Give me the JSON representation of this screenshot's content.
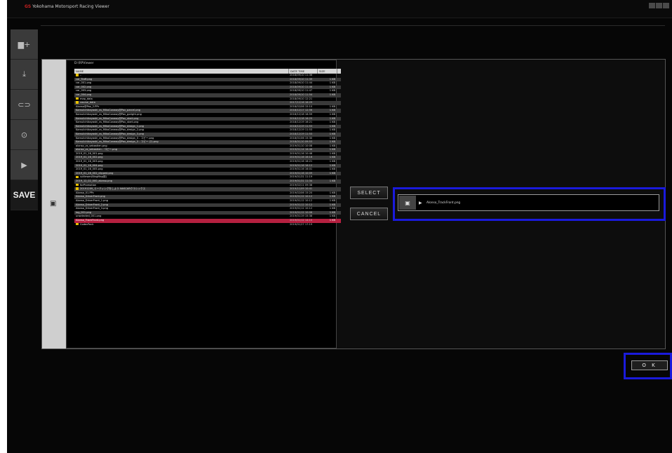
{
  "window": {
    "logo": "GS",
    "title": "Yokohama Motorsport Racing",
    "subtitle": "Viewer"
  },
  "sidebar": {
    "items": [
      {
        "name": "add-layer",
        "glyph": "▆+"
      },
      {
        "name": "import",
        "glyph": "⤓"
      },
      {
        "name": "vehicle",
        "glyph": "⊂⊃"
      },
      {
        "name": "gauge",
        "glyph": "⊙"
      },
      {
        "name": "play",
        "glyph": "▶"
      },
      {
        "name": "save",
        "label": "SAVE"
      }
    ]
  },
  "list": {
    "path": "D:\\RPViewer",
    "columns": [
      "NAME",
      "DATE TIME",
      "SIZE"
    ],
    "rows": [
      {
        "name": "..",
        "date": "2018/09/10 11:36",
        "size": "",
        "folder": true
      },
      {
        "name": "car_Traff.png",
        "date": "2018/09/10 11:39",
        "size": "1 KB"
      },
      {
        "name": "car_001.png",
        "date": "2018/09/10 11:44",
        "size": "1 KB"
      },
      {
        "name": "car_002.png",
        "date": "2018/09/10 11:46",
        "size": "1 KB"
      },
      {
        "name": "car_003.png",
        "date": "2018/09/10 11:47",
        "size": "1 KB"
      },
      {
        "name": "car_004.png",
        "date": "2018/09/10 11:54",
        "size": "1 KB"
      },
      {
        "name": "map_data",
        "date": "2018/09/10 12:21",
        "size": "",
        "folder": true
      },
      {
        "name": "course_data",
        "date": "2017/12/16 16:29",
        "size": "",
        "folder": true
      },
      {
        "name": "Alonso@Pax_2.PPc",
        "date": "2018/02/06 15:10",
        "size": "1 KB"
      },
      {
        "name": "Kamuiichikayashi_vs_MikoConway@Pax_parcel.png",
        "date": "2018/12/17 12:56",
        "size": "1 KB"
      },
      {
        "name": "Kamuiichikayashi_vs_MikoConway@Pax_goright.png",
        "date": "2018/12/18 16:59",
        "size": "1 KB"
      },
      {
        "name": "Kamuiichikayashi_vs_MikoConway@Pax_start.png",
        "date": "2018/12/18 16:25",
        "size": "1 KB"
      },
      {
        "name": "Kamuiichikayashi_vs_MikoConway@Pax_start.png",
        "date": "2018/12/19 16:21",
        "size": "1 KB"
      },
      {
        "name": "Kamuiichikayashi_vs_MikoConway@Pax_design_1.png",
        "date": "2018/12/19 11:53",
        "size": "1 KB"
      },
      {
        "name": "Kamuiichikayashi_vs_MikoConway@Pax_design_2.png",
        "date": "2018/12/19 11:53",
        "size": "1 KB"
      },
      {
        "name": "Kamuiichikayashi_vs_MikoConway@Pax_design_3.png",
        "date": "2018/12/19 11:53",
        "size": "1 KB"
      },
      {
        "name": "Kamuiichikayashi_vs_MikoConway@Pax_design_3 - コピー.png",
        "date": "2018/01/06 15:30",
        "size": "1 KB"
      },
      {
        "name": "Kamuiichikayashi_vs_MikoConway@Pax_design_3 - コピー (2).png",
        "date": "2018/01/10 09:53",
        "size": "1 KB"
      },
      {
        "name": "alonso_vs_sebastien.png",
        "date": "2019/01/10 10:08",
        "size": "1 KB"
      },
      {
        "name": "alonso_vs_sebastien - コピー.png",
        "date": "2019/01/14 16:46",
        "size": "1 KB"
      },
      {
        "name": "2019_01_16_001.png",
        "date": "2019/01/16 10:48",
        "size": "1 KB"
      },
      {
        "name": "2019_01_16_002.png",
        "date": "2019/01/16 16:16",
        "size": "1 KB"
      },
      {
        "name": "2019_01_16_003.png",
        "date": "2019/01/16 16:21",
        "size": "1 KB"
      },
      {
        "name": "2019_01_16_004.png",
        "date": "2019/01/16 16:12",
        "size": "1 KB"
      },
      {
        "name": "2019_01_16_005.png",
        "date": "2019/01/16 16:01",
        "size": "1 KB"
      },
      {
        "name": "2019_01_16_002_clipped.png",
        "date": "2019/01/16 10:09",
        "size": "1 KB"
      },
      {
        "name": "rpViewer(BingMap用)",
        "date": "2019/01/31 11:19",
        "size": "",
        "folder": true
      },
      {
        "name": "2019_12_02_000_alonso.png",
        "date": "2019/01/31 11:34",
        "size": "1 KB"
      },
      {
        "name": "forPromotion",
        "date": "2019/02/11 09:38",
        "size": "",
        "folder": true
      },
      {
        "name": "20191209_ミーティングをしよう NASCARクラシックス",
        "date": "2019/11/09 10:41",
        "size": "",
        "folder": true
      },
      {
        "name": "Alonso_01.PPc",
        "date": "2019/02/06 15:20",
        "size": "1 KB"
      },
      {
        "name": "Alonso_DriverFront.png",
        "date": "2019/01/12 10:12",
        "size": "1 KB"
      },
      {
        "name": "Alonso_DriverFront_1.png",
        "date": "2019/01/12 10:12",
        "size": "1 KB"
      },
      {
        "name": "Alonso_DriverFront_2.png",
        "date": "2019/01/12 10:12",
        "size": "1 KB"
      },
      {
        "name": "Alonso_DriverFront_3.png",
        "date": "2019/01/12 10:12",
        "size": "1 KB"
      },
      {
        "name": "log_001.png",
        "date": "2019/01/12 10:08",
        "size": "1 KB"
      },
      {
        "name": "unselected_001.png",
        "date": "2019/01/19 15:38",
        "size": "1 KB"
      },
      {
        "name": "Alonso_TrackFront.png",
        "date": "2019/01/12 14:10",
        "size": "1 KB",
        "selected": true
      },
      {
        "name": "CodecPack",
        "date": "2019/01/27 17:19",
        "size": "",
        "folder": true
      }
    ]
  },
  "buttons": {
    "select": "SELECT",
    "cancel": "CANCEL",
    "ok": "O K"
  },
  "selected_file": {
    "name": "Alonso_TrackFront.png"
  }
}
